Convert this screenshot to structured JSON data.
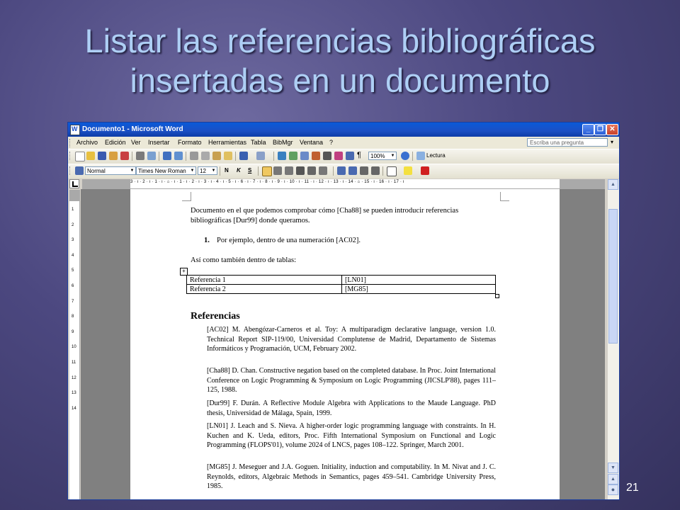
{
  "slide": {
    "title_line1": "Listar las referencias bibliográficas",
    "title_line2": "insertadas en un documento",
    "number": "21"
  },
  "window": {
    "title": "Documento1 - Microsoft Word",
    "buttons": {
      "minimize": "_",
      "restore": "❐",
      "close": "✕"
    }
  },
  "menu": {
    "items": [
      "Archivo",
      "Edición",
      "Ver",
      "Insertar",
      "Formato",
      "Herramientas",
      "Tabla",
      "BibMgr",
      "Ventana",
      "?"
    ],
    "ask_placeholder": "Escriba una pregunta"
  },
  "toolbar_standard": {
    "zoom": "100%",
    "read_label": "Lectura"
  },
  "toolbar_format": {
    "style": "Normal",
    "font": "Times New Roman",
    "size": "12",
    "bold": "N",
    "italic": "K",
    "underline": "S"
  },
  "ruler": {
    "horizontal": "3 · ı · 2 · ı · 1 · ı · ⌂ · ı · 1 · ı · 2 · ı · 3 · ı · 4 · ı · 5 · ı · 6 · ı · 7 · ı · 8 · ı · 9 · ı · 10 · ı · 11 · ı · 12 · ı · 13 · ı · 14 · ⌂ · 15 · ı · 16 · ı · 17 · ı",
    "vertical": [
      "1",
      "2",
      "3",
      "4",
      "5",
      "6",
      "7",
      "8",
      "9",
      "10",
      "11",
      "12",
      "13",
      "14"
    ]
  },
  "document": {
    "intro": "Documento en el que podemos comprobar cómo [Cha88] se pueden introducir referencias bibliográficas [Dur99] donde queramos.",
    "list_number": "1.",
    "list_text": "Por ejemplo, dentro de una numeración [AC02].",
    "table_intro": "Así como también dentro de tablas:",
    "table": [
      [
        "Referencia 1",
        "[LN01]"
      ],
      [
        "Referencia 2",
        "[MG85]"
      ]
    ],
    "references_heading": "Referencias",
    "references": [
      {
        "key": "[AC02]",
        "text": "M. Abengózar-Carneros et al. Toy: A multiparadigm declarative language, version 1.0. Technical Report SIP-119/00, Universidad Complutense de Madrid, Departamento de Sistemas Informáticos y Programación, UCM, February 2002."
      },
      {
        "key": "[Cha88]",
        "text": "D. Chan. Constructive negation based on the completed database. In Proc. Joint International Conference on Logic Programming & Symposium on Logic Programming (JICSLP'88), pages 111–125, 1988."
      },
      {
        "key": "[Dur99]",
        "text": "F. Durán. A Reflective Module Algebra with Applications to the Maude Language. PhD thesis, Universidad de Málaga, Spain, 1999."
      },
      {
        "key": "[LN01]",
        "text": "J. Leach and S. Nieva. A higher-order logic programming language with constraints. In H. Kuchen and K. Ueda, editors, Proc. Fifth International Symposium on Functional and Logic Programming (FLOPS'01), volume 2024 of LNCS, pages 108–122. Springer, March 2001."
      },
      {
        "key": "[MG85]",
        "text": "J. Meseguer and J.A. Goguen. Initiality, induction and computability. In M. Nivat and J. C. Reynolds, editors, Algebraic Methods in Semantics, pages 459–541. Cambridge University Press, 1985."
      }
    ]
  },
  "colors": {
    "titlebar": "#0a5ad8",
    "slide_title": "#aecff5",
    "spell_red": "#e02020",
    "grammar_green": "#2a9a2a"
  }
}
